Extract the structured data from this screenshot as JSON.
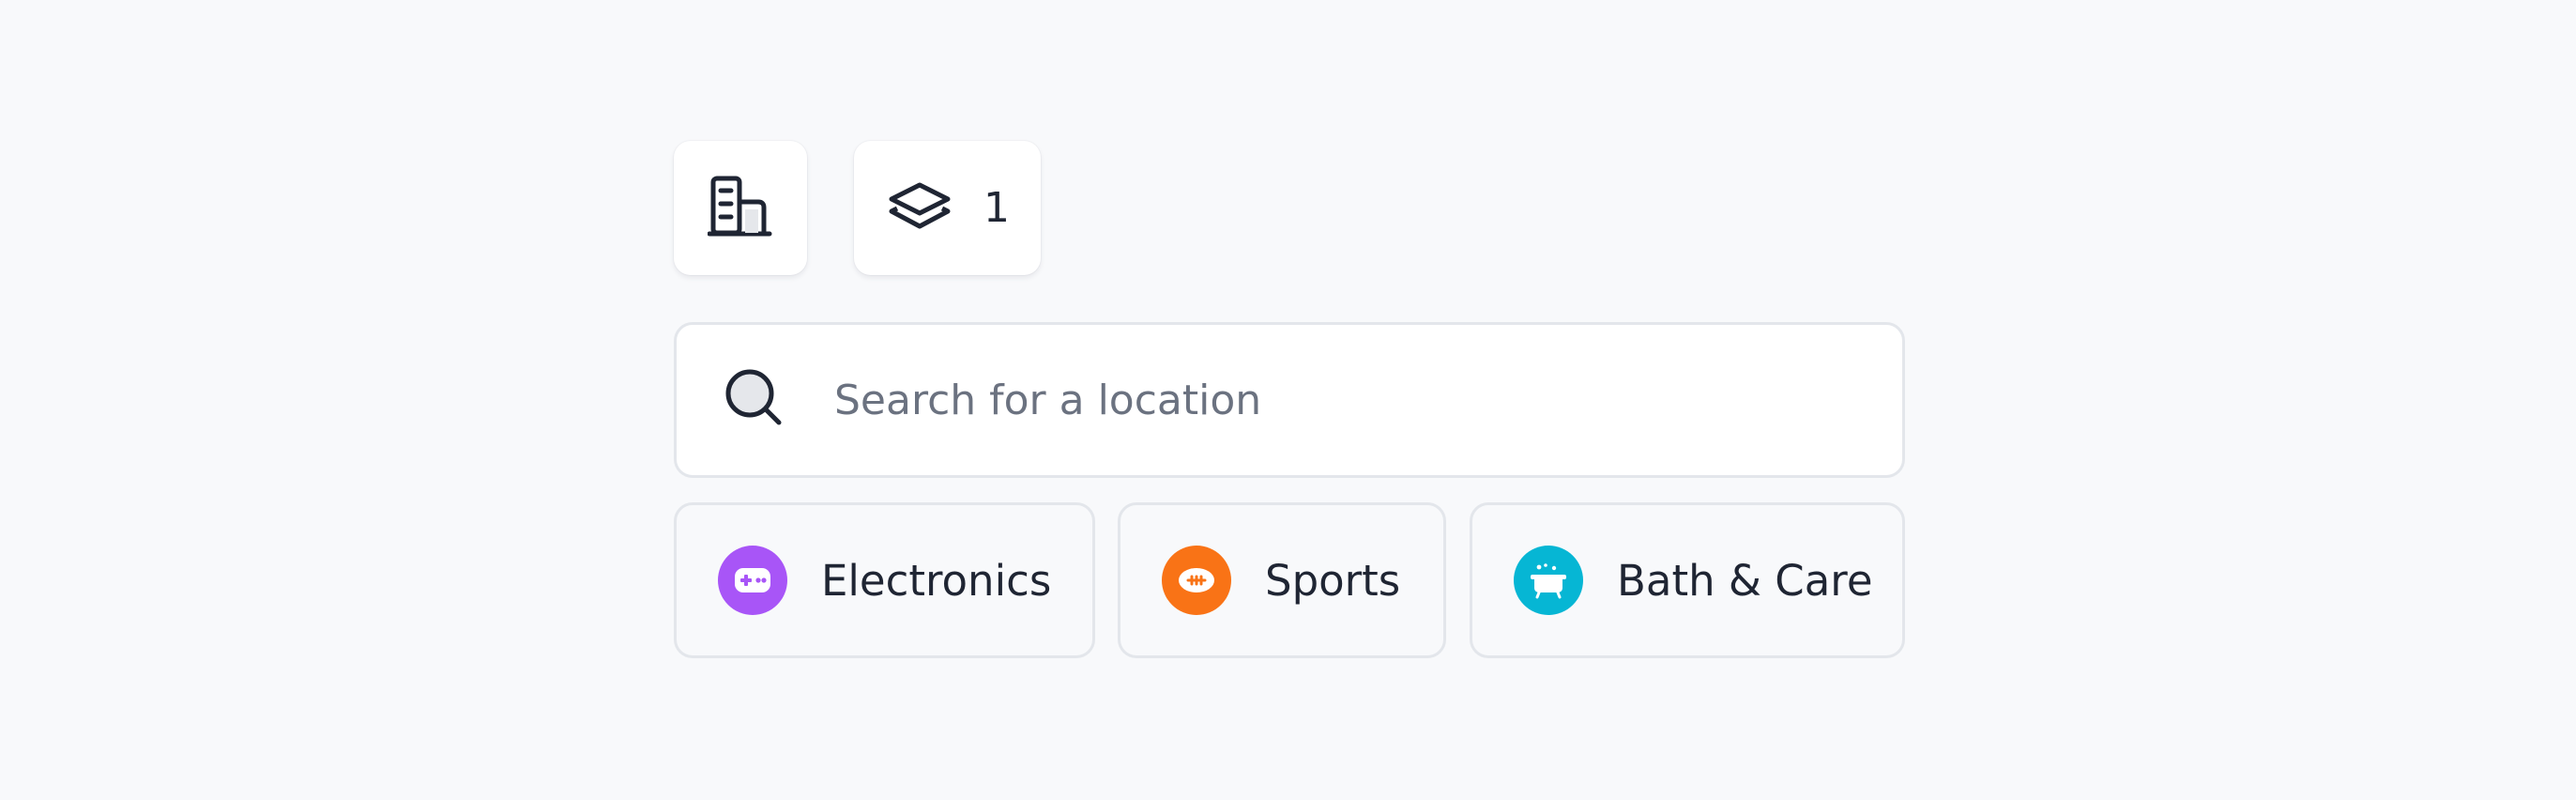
{
  "toolbar": {
    "buildings_icon": "buildings-icon",
    "layers_icon": "layers-icon",
    "layers_count": "1"
  },
  "search": {
    "icon": "search-icon",
    "placeholder": "Search for a location",
    "value": ""
  },
  "categories": [
    {
      "label": "Electronics",
      "icon": "gamepad-icon",
      "color": "#a855f7"
    },
    {
      "label": "Sports",
      "icon": "football-icon",
      "color": "#f97316"
    },
    {
      "label": "Bath & Care",
      "icon": "bathtub-icon",
      "color": "#06b6d4"
    }
  ],
  "colors": {
    "background": "#f8f9fb",
    "text": "#1f2533",
    "placeholder": "#6b7280",
    "border": "#e3e6eb"
  }
}
